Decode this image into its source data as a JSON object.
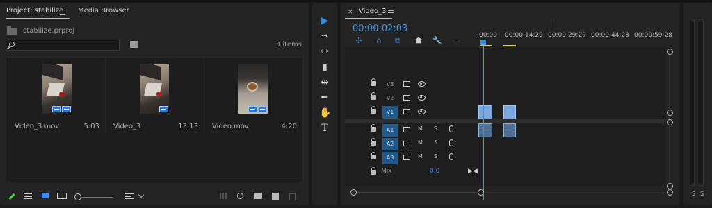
{
  "project_panel": {
    "tabs": [
      {
        "label": "Project: stabilize"
      },
      {
        "label": "Media Browser"
      }
    ],
    "project_file": "stabilize.prproj",
    "search_placeholder": "",
    "items_count": "3 items",
    "clips": [
      {
        "name": "Video_3.mov",
        "duration": "5:03"
      },
      {
        "name": "Video_3",
        "duration": "13:13"
      },
      {
        "name": "Video.mov",
        "duration": "4:20"
      }
    ]
  },
  "timeline": {
    "title": "Video_3",
    "timecode": "00:00:02:03",
    "ruler_labels": [
      ":00:00",
      "00:00:14:29",
      "00:00:29:29",
      "00:00:44:28",
      "00:00:59:28"
    ],
    "video_tracks": [
      "V3",
      "V2",
      "V1"
    ],
    "audio_tracks": [
      "A1",
      "A2",
      "A3"
    ],
    "mute_label": "M",
    "solo_label": "S",
    "mix_label": "Mix",
    "mix_value": "0.0"
  },
  "meter": {
    "left_label": "S",
    "right_label": "S"
  },
  "colors": {
    "accent": "#3d8ee8",
    "target_track": "#1e5a8c",
    "video_clip": "#7aa8de",
    "audio_clip": "#4f6f93",
    "work_area": "#d7d72d"
  }
}
